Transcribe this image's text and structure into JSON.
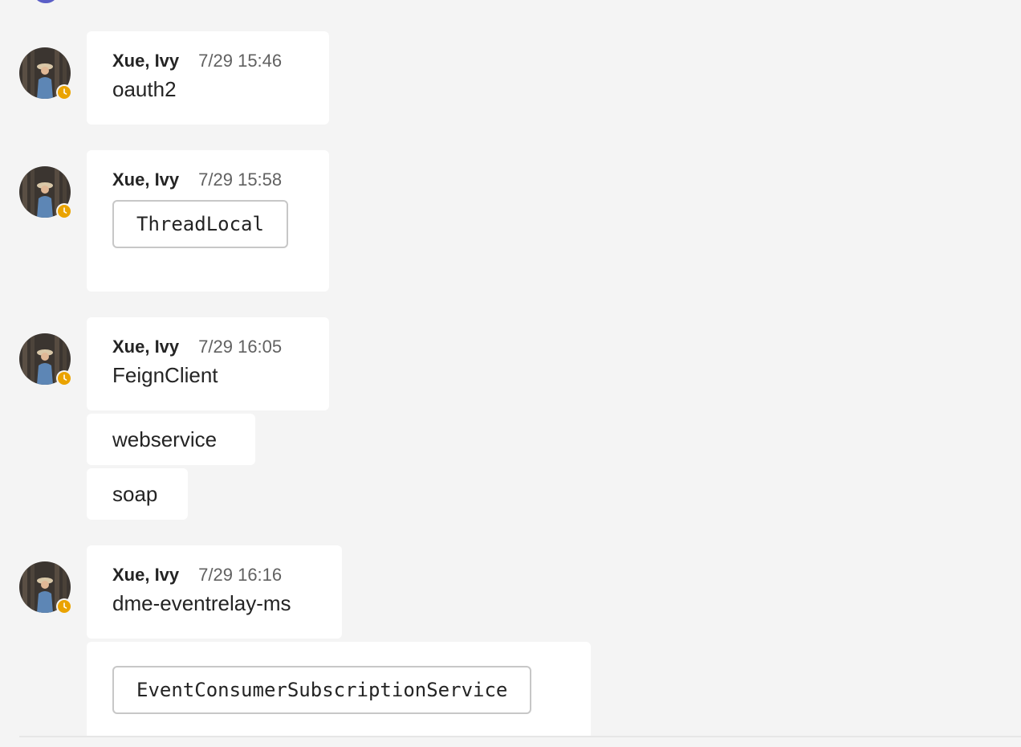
{
  "messages": [
    {
      "author": "Xue, Ivy",
      "time": "7/29 15:46",
      "text": "oauth2"
    },
    {
      "author": "Xue, Ivy",
      "time": "7/29 15:58",
      "code": "ThreadLocal"
    },
    {
      "author": "Xue, Ivy",
      "time": "7/29 16:05",
      "text": "FeignClient",
      "followups": [
        "webservice",
        "soap"
      ]
    },
    {
      "author": "Xue, Ivy",
      "time": "7/29 16:16",
      "text": "dme-eventrelay-ms",
      "followup_code": "EventConsumerSubscriptionService"
    }
  ],
  "presence_status": "away",
  "colors": {
    "background": "#f4f4f4",
    "bubble": "#ffffff",
    "away": "#eaa300",
    "timestamp": "#616161"
  }
}
